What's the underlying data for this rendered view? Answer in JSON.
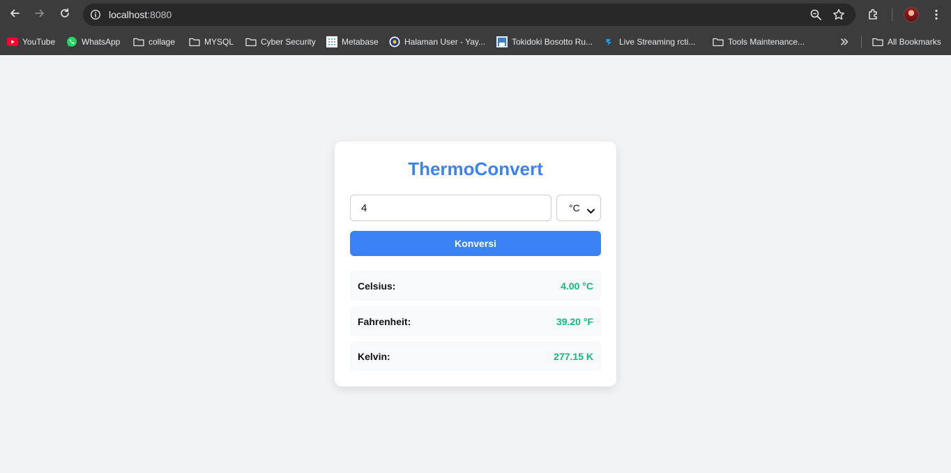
{
  "browser": {
    "url_host": "localhost",
    "url_port": ":8080"
  },
  "bookmarks": [
    {
      "label": "YouTube",
      "icon": "youtube-icon"
    },
    {
      "label": "WhatsApp",
      "icon": "whatsapp-icon"
    },
    {
      "label": "collage",
      "icon": "folder-icon"
    },
    {
      "label": "MYSQL",
      "icon": "folder-icon"
    },
    {
      "label": "Cyber Security",
      "icon": "folder-icon"
    },
    {
      "label": "Metabase",
      "icon": "metabase-icon"
    },
    {
      "label": "Halaman User - Yay...",
      "icon": "site-icon"
    },
    {
      "label": "Tokidoki Bosotto Ru...",
      "icon": "site-icon"
    },
    {
      "label": "Live Streaming rcti...",
      "icon": "rcti-icon"
    },
    {
      "label": "Tools Maintenance...",
      "icon": "folder-icon"
    }
  ],
  "all_bookmarks_label": "All Bookmarks",
  "app": {
    "title": "ThermoConvert",
    "input_value": "4",
    "unit_selected": "°C",
    "convert_label": "Konversi",
    "results": [
      {
        "label": "Celsius:",
        "value": "4.00 °C"
      },
      {
        "label": "Fahrenheit:",
        "value": "39.20 °F"
      },
      {
        "label": "Kelvin:",
        "value": "277.15 K"
      }
    ]
  },
  "colors": {
    "accent": "#3b82f6",
    "result_value": "#10b981",
    "page_bg": "#f2f3f5"
  }
}
